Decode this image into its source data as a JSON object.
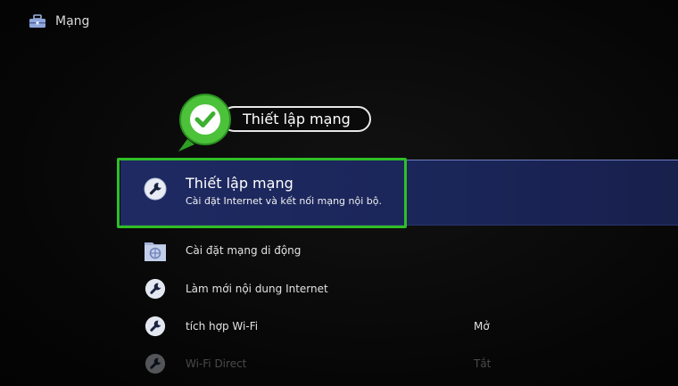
{
  "header": {
    "title": "Mạng",
    "icon": "toolbox-icon"
  },
  "callout": {
    "text": "Thiết lập mạng",
    "icon": "check-badge-icon",
    "color": "#3cc32d"
  },
  "selected": {
    "title": "Thiết lập mạng",
    "subtitle": "Cài đặt Internet và kết nối mạng nội bộ.",
    "icon": "wrench-icon",
    "highlight_color": "#2fbf27"
  },
  "items": [
    {
      "label": "Cài đặt mạng di động",
      "value": "",
      "icon": "network-folder-icon",
      "enabled": true
    },
    {
      "label": "Làm mới nội dung Internet",
      "value": "",
      "icon": "wrench-icon",
      "enabled": true
    },
    {
      "label": "tích hợp Wi-Fi",
      "value": "Mở",
      "icon": "wrench-icon",
      "enabled": true
    },
    {
      "label": "Wi-Fi Direct",
      "value": "Tắt",
      "icon": "wrench-icon",
      "enabled": false
    }
  ]
}
